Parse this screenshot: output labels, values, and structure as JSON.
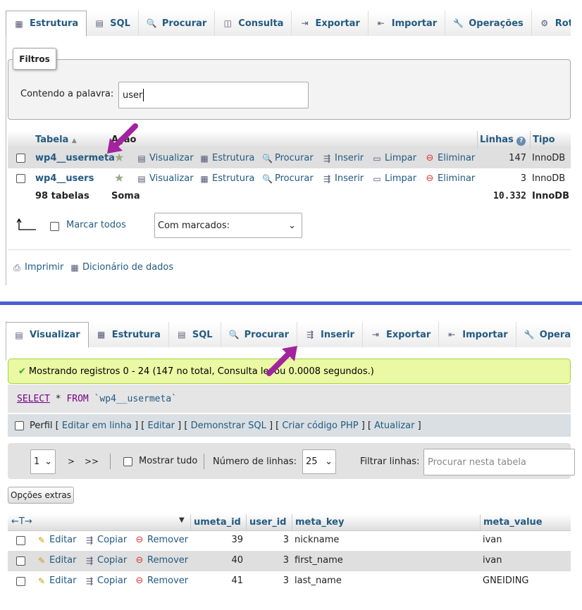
{
  "top": {
    "tabs": [
      {
        "label": "Estrutura",
        "icon": "structure-icon"
      },
      {
        "label": "SQL",
        "icon": "sql-icon"
      },
      {
        "label": "Procurar",
        "icon": "search-icon"
      },
      {
        "label": "Consulta",
        "icon": "query-icon"
      },
      {
        "label": "Exportar",
        "icon": "export-icon"
      },
      {
        "label": "Importar",
        "icon": "import-icon"
      },
      {
        "label": "Operações",
        "icon": "wrench-icon"
      },
      {
        "label": "Rotina",
        "icon": "routine-icon"
      }
    ],
    "filters": {
      "legend": "Filtros",
      "label": "Contendo a palavra:",
      "value": "user"
    },
    "table_headers": {
      "table": "Tabela",
      "action": "Ação",
      "rows": "Linhas",
      "type": "Tipo"
    },
    "rows": [
      {
        "name": "wp4__usermeta",
        "actions": [
          "Visualizar",
          "Estrutura",
          "Procurar",
          "Inserir",
          "Limpar",
          "Eliminar"
        ],
        "rows": "147",
        "type": "InnoDB"
      },
      {
        "name": "wp4__users",
        "actions": [
          "Visualizar",
          "Estrutura",
          "Procurar",
          "Inserir",
          "Limpar",
          "Eliminar"
        ],
        "rows": "3",
        "type": "InnoDB"
      }
    ],
    "summary": {
      "count": "98 tabelas",
      "label": "Soma",
      "rows": "10.332",
      "type": "InnoDB"
    },
    "check_all": "Marcar todos",
    "with_selected": "Com marcados:",
    "footer": {
      "print": "Imprimir",
      "dictionary": "Dicionário de dados"
    }
  },
  "bottom": {
    "tabs": [
      {
        "label": "Visualizar",
        "icon": "browse-icon"
      },
      {
        "label": "Estrutura",
        "icon": "structure-icon"
      },
      {
        "label": "SQL",
        "icon": "sql-icon"
      },
      {
        "label": "Procurar",
        "icon": "search-icon"
      },
      {
        "label": "Inserir",
        "icon": "insert-icon"
      },
      {
        "label": "Exportar",
        "icon": "export-icon"
      },
      {
        "label": "Importar",
        "icon": "import-icon"
      },
      {
        "label": "Operaçõe",
        "icon": "wrench-icon"
      }
    ],
    "success_message": "Mostrando registros 0 - 24 (147 no total, Consulta levou 0.0008 segundos.)",
    "sql": {
      "select": "SELECT",
      "star": "*",
      "from": "FROM",
      "table": "`wp4__usermeta`"
    },
    "profile": {
      "label": "Perfil",
      "links": [
        "Editar em linha",
        "Editar",
        "Demonstrar SQL",
        "Criar código PHP",
        "Atualizar"
      ]
    },
    "nav": {
      "page": "1",
      "next": ">",
      "last": ">>",
      "show_all": "Mostrar tudo",
      "rows_label": "Número de linhas:",
      "rows_value": "25",
      "filter_label": "Filtrar linhas:",
      "filter_placeholder": "Procurar nesta tabela"
    },
    "extra_options": "Opções extras",
    "columns": [
      "umeta_id",
      "user_id",
      "meta_key",
      "meta_value"
    ],
    "row_actions": {
      "edit": "Editar",
      "copy": "Copiar",
      "delete": "Remover"
    },
    "data": [
      {
        "umeta_id": "39",
        "user_id": "3",
        "meta_key": "nickname",
        "meta_value": "ivan"
      },
      {
        "umeta_id": "40",
        "user_id": "3",
        "meta_key": "first_name",
        "meta_value": "ivan"
      },
      {
        "umeta_id": "41",
        "user_id": "3",
        "meta_key": "last_name",
        "meta_value": "GNEIDING"
      }
    ]
  },
  "colors": {
    "accent": "#235a81",
    "arrow": "#a3239e",
    "divider": "#4a5fd6",
    "success_bg": "#ebf8a4"
  }
}
